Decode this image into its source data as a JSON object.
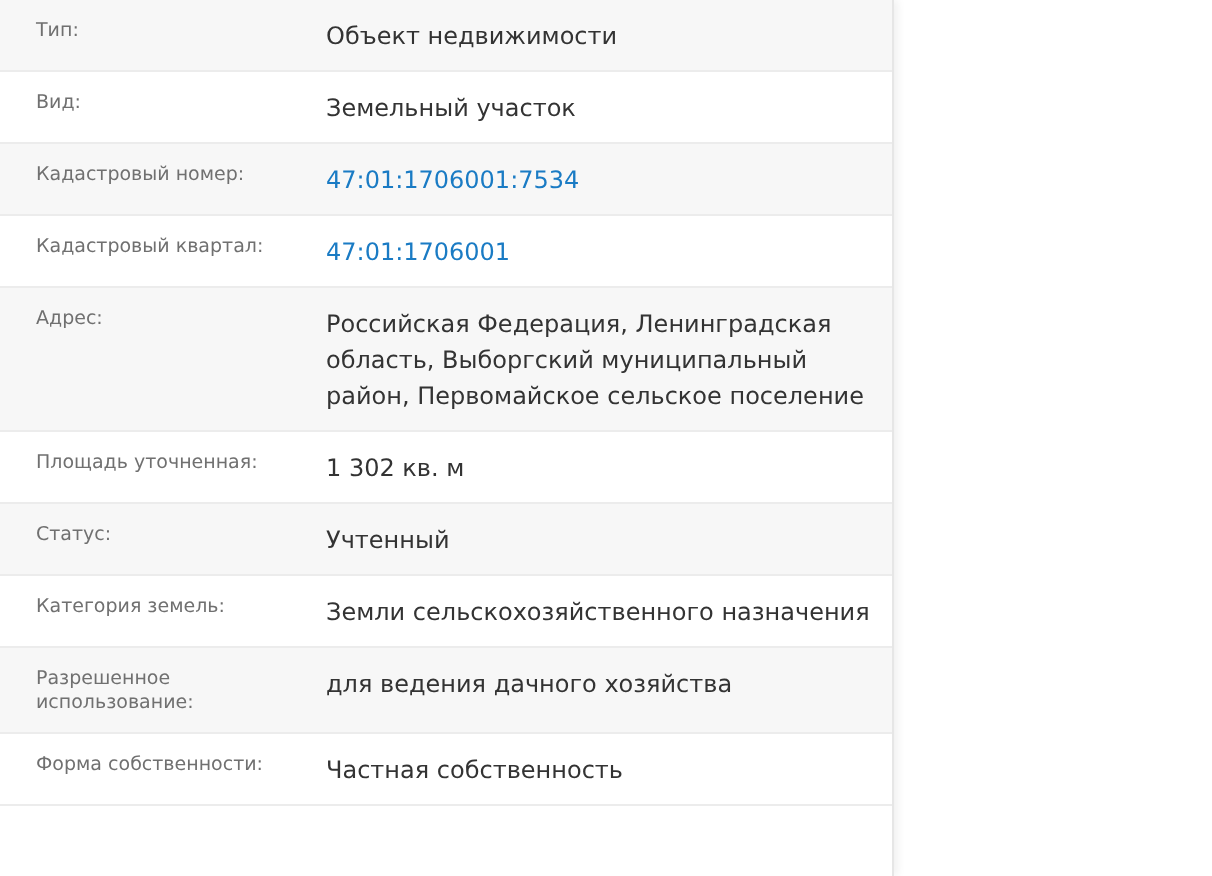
{
  "rows": [
    {
      "label": "Тип:",
      "value": "Объект недвижимости",
      "kind": "text"
    },
    {
      "label": "Вид:",
      "value": "Земельный участок",
      "kind": "text"
    },
    {
      "label": "Кадастровый номер:",
      "value": "47:01:1706001:7534",
      "kind": "link"
    },
    {
      "label": "Кадастровый квартал:",
      "value": "47:01:1706001",
      "kind": "link"
    },
    {
      "label": "Адрес:",
      "value": "Российская Федерация, Ленинградская область, Выборгский муниципальный район, Первомайское сельское поселение",
      "kind": "text"
    },
    {
      "label": "Площадь уточненная:",
      "value": "1 302 кв. м",
      "kind": "text"
    },
    {
      "label": "Статус:",
      "value": "Учтенный",
      "kind": "text"
    },
    {
      "label": "Категория земель:",
      "value": "Земли сельскохозяйственного назначения",
      "kind": "text"
    },
    {
      "label": "Разрешенное использование:",
      "value": "для ведения дачного хозяйства",
      "kind": "text"
    },
    {
      "label": "Форма собственности:",
      "value": "Частная собственность",
      "kind": "text"
    }
  ]
}
